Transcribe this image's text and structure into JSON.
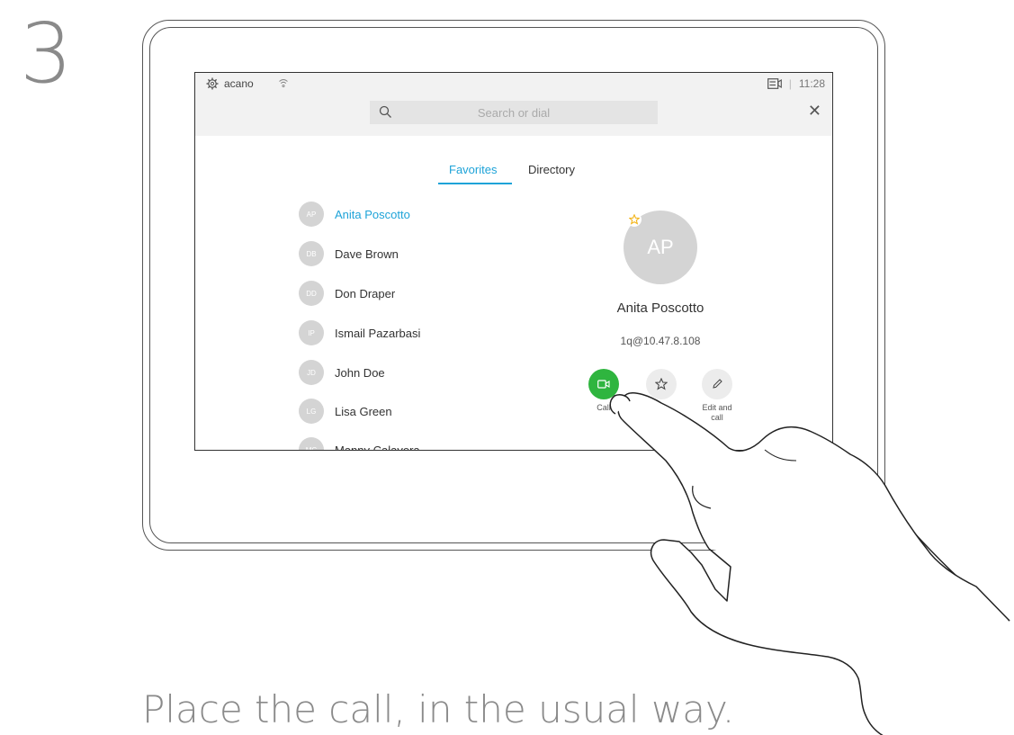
{
  "step_number": "3",
  "caption": "Place the call, in the usual way.",
  "statusbar": {
    "brand": "acano",
    "time": "11:28",
    "separator": "|"
  },
  "search": {
    "placeholder": "Search or dial"
  },
  "tabs": [
    {
      "label": "Favorites",
      "active": true
    },
    {
      "label": "Directory",
      "active": false
    }
  ],
  "contacts": [
    {
      "initials": "AP",
      "name": "Anita Poscotto",
      "selected": true
    },
    {
      "initials": "DB",
      "name": "Dave Brown"
    },
    {
      "initials": "DD",
      "name": "Don Draper"
    },
    {
      "initials": "IP",
      "name": "Ismail Pazarbasi"
    },
    {
      "initials": "JD",
      "name": "John Doe"
    },
    {
      "initials": "LG",
      "name": "Lisa Green"
    },
    {
      "initials": "MC",
      "name": "Manny Calavera"
    }
  ],
  "detail": {
    "initials": "AP",
    "name": "Anita Poscotto",
    "uri": "1q@10.47.8.108"
  },
  "actions": {
    "call": "Call",
    "edit_line1": "Edit and",
    "edit_line2": "call"
  },
  "colors": {
    "accent": "#1ea3d8",
    "call_green": "#2fb53f",
    "favorite_star": "#f3b51b"
  }
}
